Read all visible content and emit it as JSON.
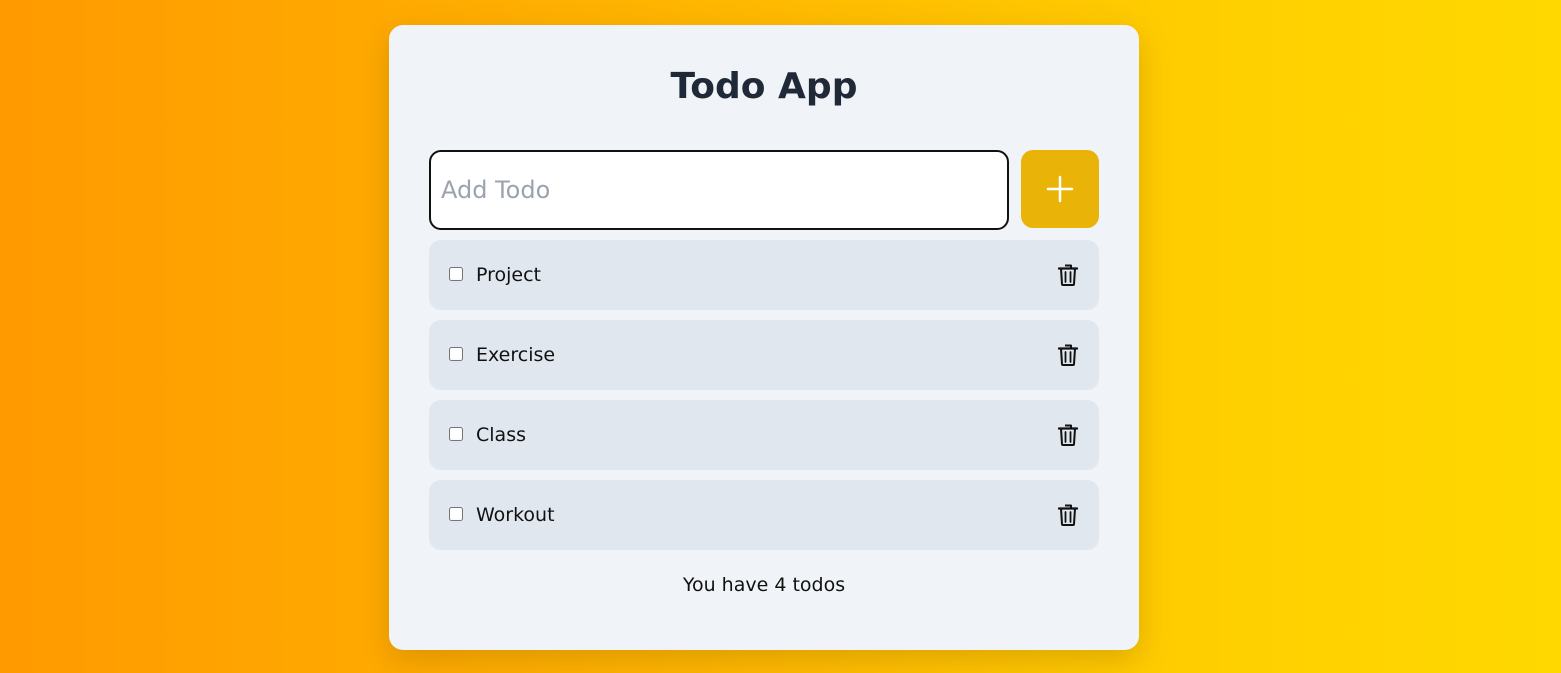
{
  "app": {
    "title": "Todo App"
  },
  "add_form": {
    "input_value": "",
    "input_placeholder": "Add Todo",
    "add_button_icon": "plus-icon"
  },
  "todos": [
    {
      "label": "Project",
      "checked": false
    },
    {
      "label": "Exercise",
      "checked": false
    },
    {
      "label": "Class",
      "checked": false
    },
    {
      "label": "Workout",
      "checked": false
    }
  ],
  "footer": {
    "count_text": "You have 4 todos"
  },
  "colors": {
    "background_start": "#ff9a00",
    "background_end": "#ffd800",
    "card": "#f0f3f7",
    "item": "#e1e7ef",
    "accent": "#eab308",
    "title": "#1f2937"
  },
  "icons": {
    "delete": "trash-icon",
    "add": "plus-icon"
  }
}
